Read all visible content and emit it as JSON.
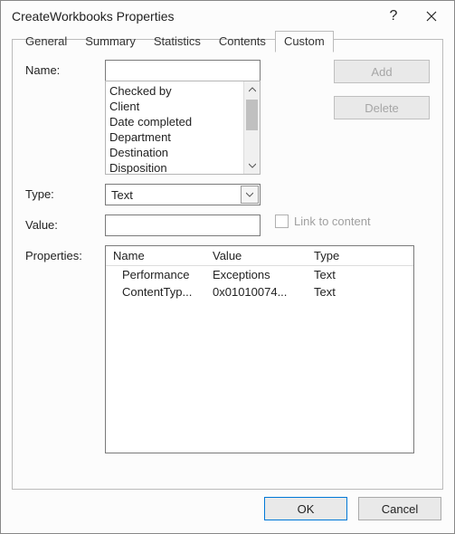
{
  "titlebar": {
    "title": "CreateWorkbooks Properties"
  },
  "tabs": {
    "general": "General",
    "summary": "Summary",
    "statistics": "Statistics",
    "contents": "Contents",
    "custom": "Custom"
  },
  "labels": {
    "name": "Name:",
    "type": "Type:",
    "value": "Value:",
    "properties": "Properties:",
    "link_to_content": "Link to content"
  },
  "name_field": {
    "value": ""
  },
  "name_list": {
    "items": {
      "0": "Checked by",
      "1": "Client",
      "2": "Date completed",
      "3": "Department",
      "4": "Destination",
      "5": "Disposition"
    }
  },
  "type_combo": {
    "value": "Text"
  },
  "value_field": {
    "value": ""
  },
  "buttons": {
    "add": "Add",
    "delete": "Delete",
    "ok": "OK",
    "cancel": "Cancel"
  },
  "properties_table": {
    "headers": {
      "name": "Name",
      "value": "Value",
      "type": "Type"
    },
    "rows": {
      "0": {
        "name": "Performance",
        "value": "Exceptions",
        "type": "Text"
      },
      "1": {
        "name": "ContentTyp...",
        "value": "0x01010074...",
        "type": "Text"
      }
    }
  }
}
